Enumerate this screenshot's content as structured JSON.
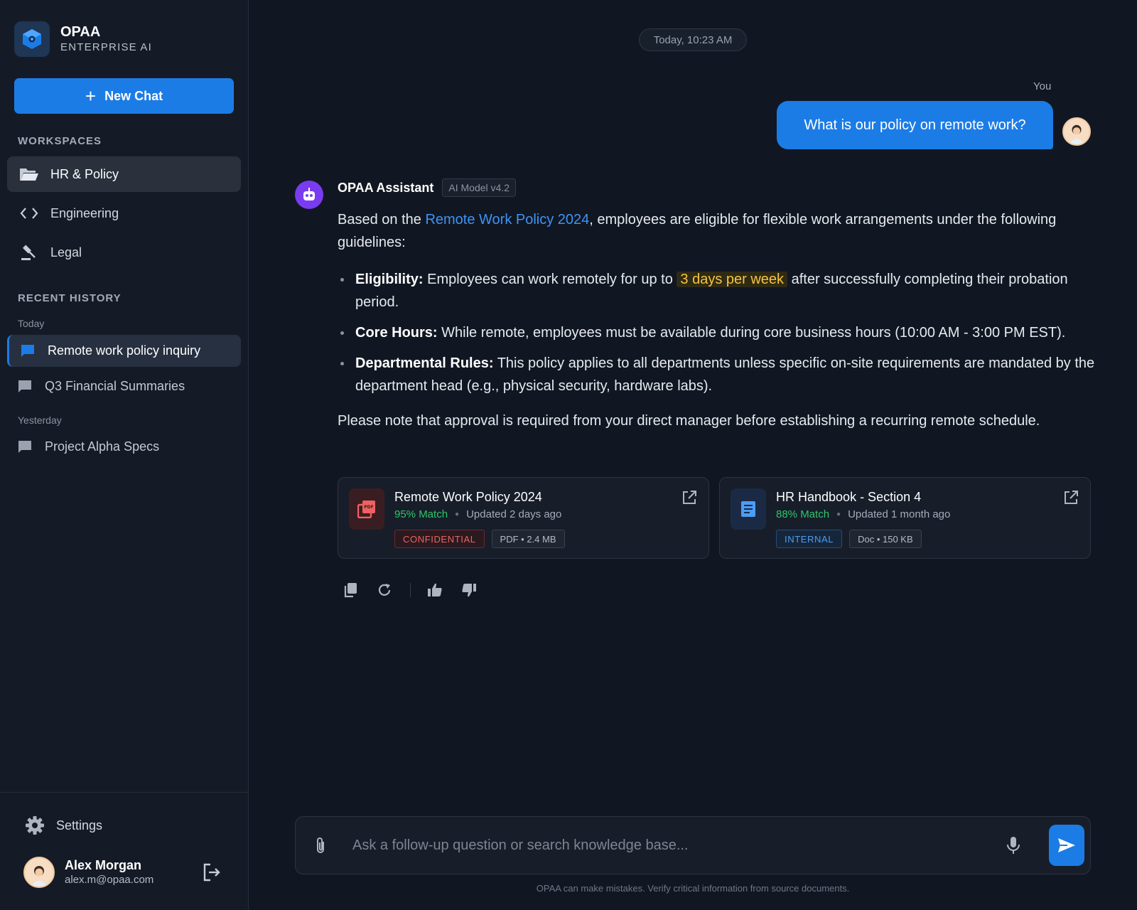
{
  "brand": {
    "name": "OPAA",
    "subtitle": "ENTERPRISE AI"
  },
  "sidebar": {
    "new_chat": "New Chat",
    "workspaces_label": "WORKSPACES",
    "workspaces": [
      {
        "label": "HR & Policy",
        "icon": "folder-open-icon",
        "active": true
      },
      {
        "label": "Engineering",
        "icon": "code-icon",
        "active": false
      },
      {
        "label": "Legal",
        "icon": "gavel-icon",
        "active": false
      }
    ],
    "history_label": "RECENT HISTORY",
    "today_label": "Today",
    "yesterday_label": "Yesterday",
    "history": [
      {
        "label": "Remote work policy inquiry",
        "active": true
      },
      {
        "label": "Q3 Financial Summaries",
        "active": false
      },
      {
        "label": "Project Alpha Specs",
        "active": false
      }
    ],
    "settings": "Settings",
    "user": {
      "name": "Alex Morgan",
      "email": "alex.m@opaa.com"
    }
  },
  "chat": {
    "timestamp": "Today, 10:23 AM",
    "you_label": "You",
    "user_message": "What is our policy on remote work?",
    "assistant_name": "OPAA Assistant",
    "model_tag": "AI Model v4.2",
    "answer": {
      "intro_before": "Based on the ",
      "intro_link": "Remote Work Policy 2024",
      "intro_after": ", employees are eligible for flexible work arrangements under the following guidelines:",
      "b1_title": "Eligibility:",
      "b1_before": " Employees can work remotely for up to ",
      "b1_highlight": "3 days per week",
      "b1_after": " after successfully completing their probation period.",
      "b2_title": "Core Hours:",
      "b2_text": " While remote, employees must be available during core business hours (10:00 AM - 3:00 PM EST).",
      "b3_title": "Departmental Rules:",
      "b3_text": " This policy applies to all departments unless specific on-site requirements are mandated by the department head (e.g., physical security, hardware labs).",
      "note": "Please note that approval is required from your direct manager before establishing a recurring remote schedule."
    },
    "sources": [
      {
        "title": "Remote Work Policy 2024",
        "match": "95% Match",
        "updated": "Updated 2 days ago",
        "tag": "CONFIDENTIAL",
        "meta": "PDF • 2.4 MB"
      },
      {
        "title": "HR Handbook - Section 4",
        "match": "88% Match",
        "updated": "Updated 1 month ago",
        "tag": "INTERNAL",
        "meta": "Doc • 150 KB"
      }
    ]
  },
  "composer": {
    "placeholder": "Ask a follow-up question or search knowledge base...",
    "disclaimer": "OPAA can make mistakes. Verify critical information from source documents."
  },
  "colors": {
    "accent": "#1c7ce6",
    "match": "#2fc46c",
    "highlight": "#f5c542",
    "confidential": "#f06161",
    "internal": "#4c9df5"
  }
}
